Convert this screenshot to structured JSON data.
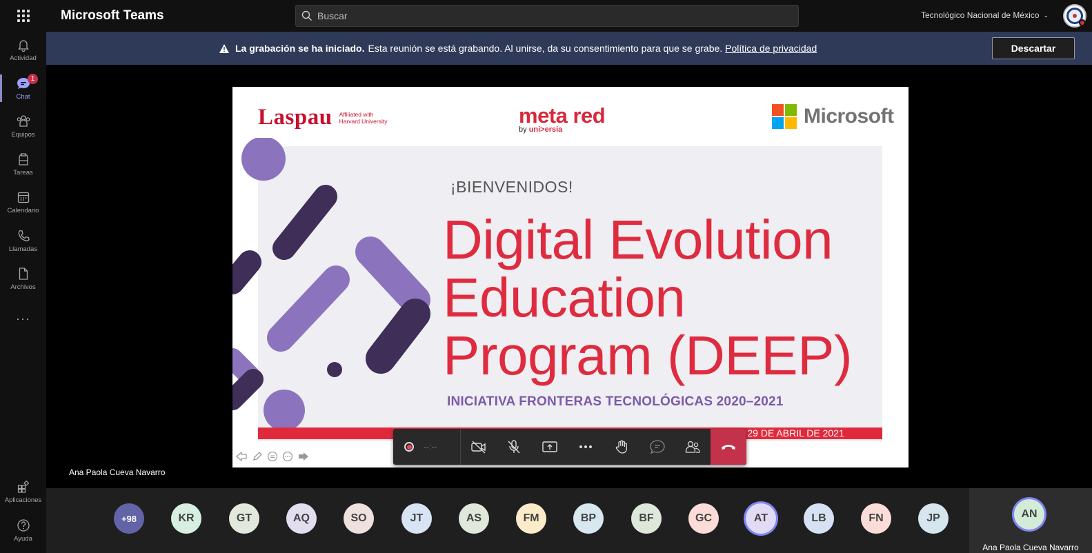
{
  "app": {
    "title": "Microsoft Teams",
    "org": "Tecnológico Nacional de México"
  },
  "search": {
    "placeholder": "Buscar"
  },
  "rail": [
    {
      "label": "Actividad",
      "icon": "bell-icon"
    },
    {
      "label": "Chat",
      "icon": "chat-icon",
      "badge": "1"
    },
    {
      "label": "Equipos",
      "icon": "teams-icon"
    },
    {
      "label": "Tareas",
      "icon": "assignments-icon"
    },
    {
      "label": "Calendario",
      "icon": "calendar-icon"
    },
    {
      "label": "Llamadas",
      "icon": "phone-icon"
    },
    {
      "label": "Archivos",
      "icon": "file-icon"
    },
    {
      "label": "Aplicaciones",
      "icon": "apps-icon"
    },
    {
      "label": "Ayuda",
      "icon": "help-icon"
    }
  ],
  "banner": {
    "bold": "La grabación se ha iniciado.",
    "text": "Esta reunión se está grabando. Al unirse, da su consentimiento para que se grabe.",
    "link": "Política de privacidad",
    "dismiss": "Descartar"
  },
  "slide": {
    "laspau": "Laspau",
    "affiliation_line1": "Affiliated with",
    "affiliation_line2": "Harvard University",
    "metared": "meta red",
    "metared_by": "by",
    "universia": "uni>ersia",
    "microsoft": "Microsoft",
    "welcome": "¡BIENVENIDOS!",
    "headline_1": "Digital Evolution",
    "headline_2": "Education",
    "headline_3": "Program (DEEP)",
    "initiative": "INICIATIVA FRONTERAS TECNOLÓGICAS 2020–2021",
    "ceremony": "CEREMONIA DE CLAUSURA - JUEVES, 29 DE ABRIL DE 2021"
  },
  "controls": {
    "timer": "--:--"
  },
  "speaker": "Ana Paola Cueva Navarro",
  "participants": [
    {
      "initials": "+98",
      "color": "#6264a7"
    },
    {
      "initials": "KR",
      "color": "#d6efe2"
    },
    {
      "initials": "GT",
      "color": "#e3e8dc"
    },
    {
      "initials": "AQ",
      "color": "#e3ddf0"
    },
    {
      "initials": "SO",
      "color": "#efe1de"
    },
    {
      "initials": "JT",
      "color": "#d8e4f3"
    },
    {
      "initials": "AS",
      "color": "#e0e8dc"
    },
    {
      "initials": "FM",
      "color": "#fcebc9"
    },
    {
      "initials": "BP",
      "color": "#d8e8ef"
    },
    {
      "initials": "BF",
      "color": "#dde8da"
    },
    {
      "initials": "GC",
      "color": "#fbdcd8"
    },
    {
      "initials": "AT",
      "color": "#e1dcf3"
    },
    {
      "initials": "LB",
      "color": "#d6e2f3"
    },
    {
      "initials": "FN",
      "color": "#fbdcd8"
    },
    {
      "initials": "JP",
      "color": "#d6e6ef"
    }
  ],
  "self": {
    "initials": "AN",
    "name": "Ana Paola Cueva Navarro",
    "color": "#d2ecd8"
  }
}
